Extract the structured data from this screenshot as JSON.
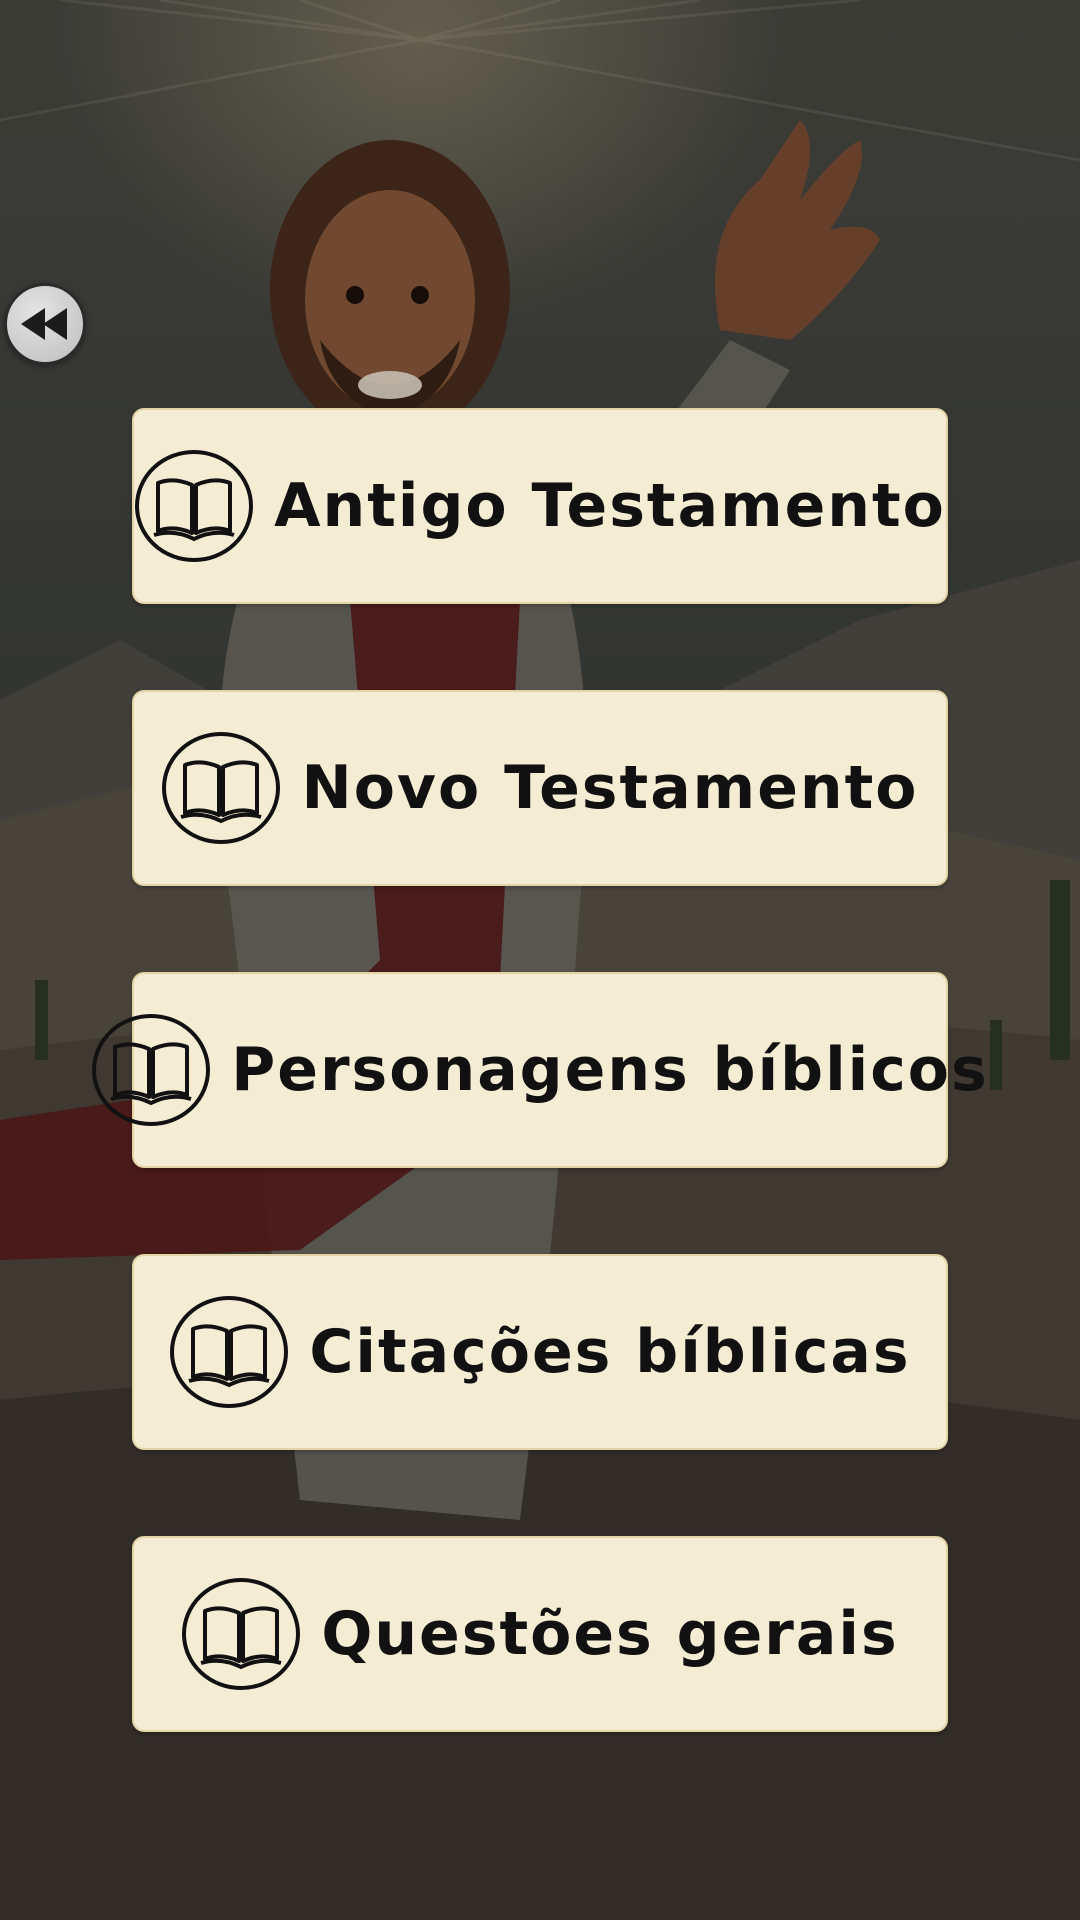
{
  "colors": {
    "button_bg": "#f5ecd4",
    "button_border": "#e3d3a6",
    "text": "#111111",
    "back_button_bg": "#cfcfcf"
  },
  "back_button": {
    "icon": "rewind-icon"
  },
  "menu": {
    "items": [
      {
        "label": "Antigo Testamento",
        "icon": "open-book-icon"
      },
      {
        "label": "Novo Testamento",
        "icon": "open-book-icon"
      },
      {
        "label": "Personagens bíblicos",
        "icon": "open-book-icon"
      },
      {
        "label": "Citações bíblicas",
        "icon": "open-book-icon"
      },
      {
        "label": "Questões gerais",
        "icon": "open-book-icon"
      }
    ]
  }
}
